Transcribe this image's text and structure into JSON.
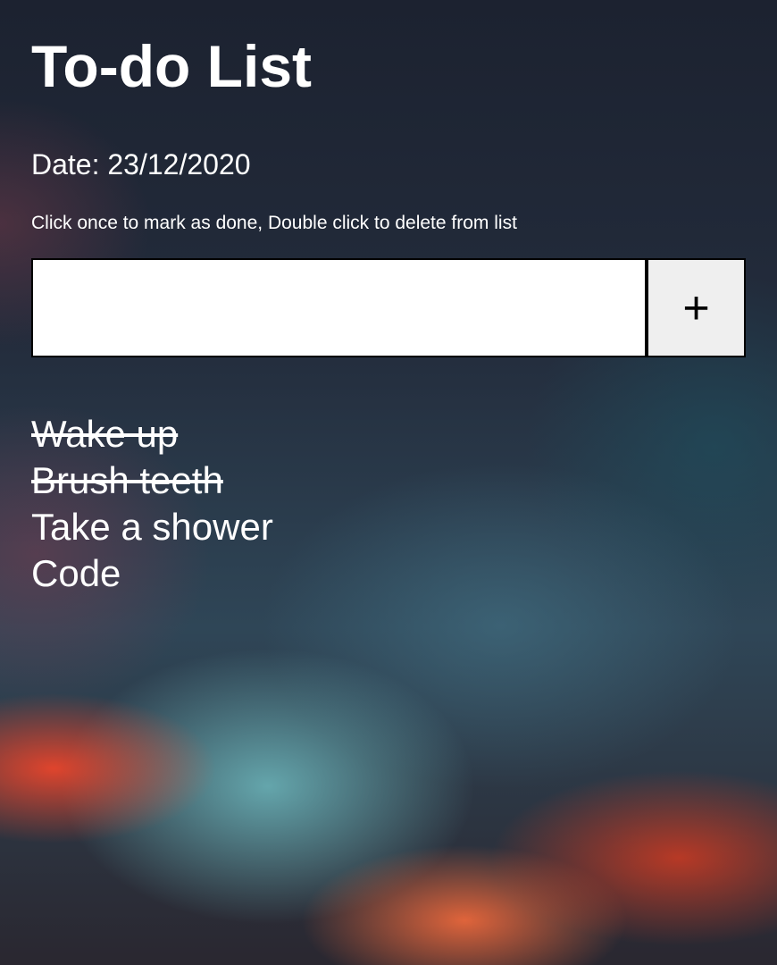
{
  "header": {
    "title": "To-do List",
    "date_line": "Date: 23/12/2020",
    "instructions": "Click once to mark as done, Double click to delete from list"
  },
  "add_form": {
    "input_value": "",
    "add_button_label": "+"
  },
  "tasks": [
    {
      "text": "Wake up",
      "done": true
    },
    {
      "text": "Brush teeth",
      "done": true
    },
    {
      "text": "Take a shower",
      "done": false
    },
    {
      "text": "Code",
      "done": false
    }
  ],
  "colors": {
    "text": "#ffffff",
    "input_background": "#ffffff",
    "button_background": "#efefef",
    "border": "#000000"
  }
}
